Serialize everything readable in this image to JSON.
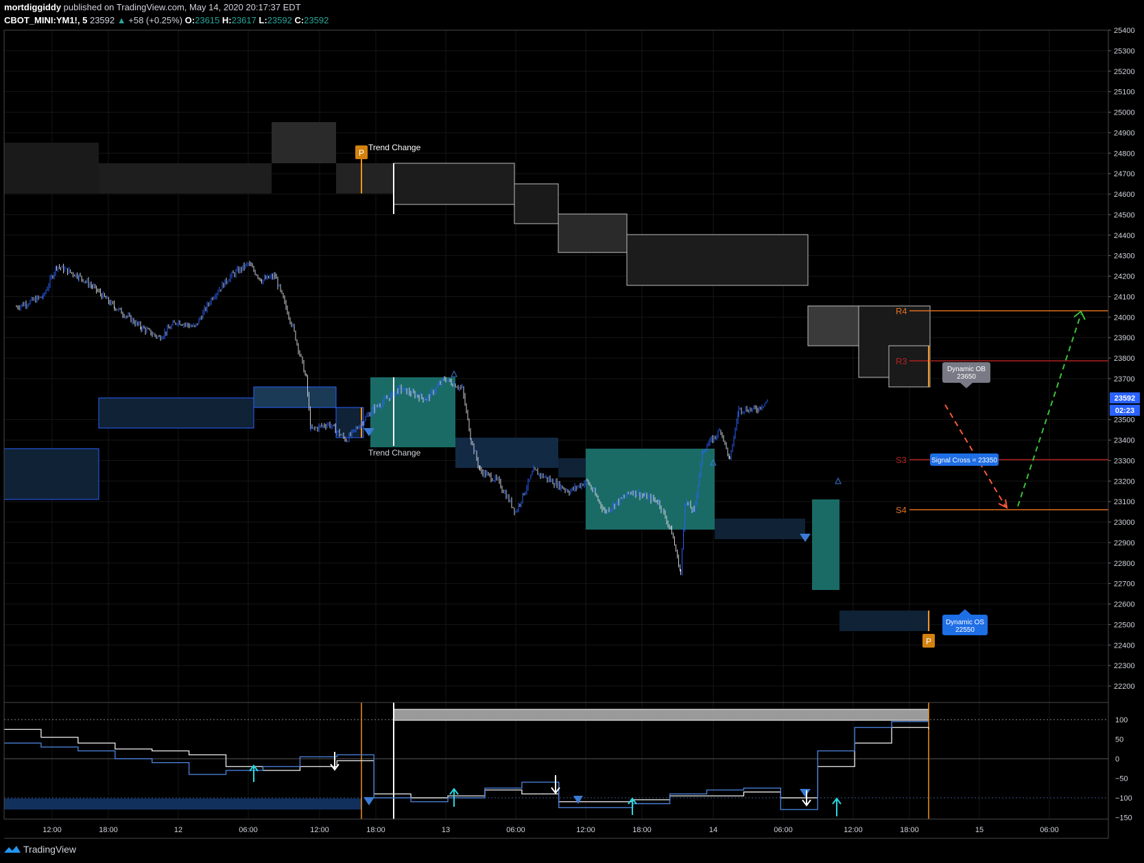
{
  "header": {
    "author": "mortdiggiddy",
    "published": "published on TradingView.com, May 14, 2020 20:17:37 EDT",
    "symbol": "CBOT_MINI:YM1!, 5",
    "last": "23592",
    "change": "+58 (+0.25%)",
    "o_label": "O:",
    "o": "23615",
    "h_label": "H:",
    "h": "23617",
    "l_label": "L:",
    "l": "23592",
    "c_label": "C:",
    "c": "23592"
  },
  "price_axis": {
    "ticks": [
      "25400",
      "25300",
      "25200",
      "25100",
      "25000",
      "24900",
      "24800",
      "24700",
      "24600",
      "24500",
      "24400",
      "24300",
      "24200",
      "24100",
      "24000",
      "23900",
      "23800",
      "23700",
      "23500",
      "23400",
      "23300",
      "23200",
      "23100",
      "23000",
      "22900",
      "22800",
      "22700",
      "22600",
      "22500",
      "22400",
      "22300",
      "22200"
    ],
    "last_price_label": "23592",
    "countdown_label": "02:23"
  },
  "osc_axis": {
    "ticks": [
      "100",
      "50",
      "0",
      "−50",
      "−100",
      "−150"
    ]
  },
  "time_axis": {
    "ticks": [
      "12:00",
      "18:00",
      "12",
      "06:00",
      "12:00",
      "18:00",
      "13",
      "06:00",
      "12:00",
      "18:00",
      "14",
      "06:00",
      "12:00",
      "18:00",
      "15",
      "06:00"
    ]
  },
  "annotations": {
    "trend_change_top": "Trend Change",
    "trend_change_bottom": "Trend Change",
    "pivot_marker": "P",
    "dynamic_ob_title": "Dynamic OB",
    "dynamic_ob_value": "23650",
    "dynamic_os_title": "Dynamic OS",
    "dynamic_os_value": "22550",
    "signal_cross": "Signal Cross = 23350",
    "r4": "R4",
    "r3": "R3",
    "s3": "S3",
    "s4": "S4"
  },
  "colors": {
    "background": "#000000",
    "bull_candle": "#2962ff",
    "bear_candle": "#d1d4dc",
    "teal_zone": "#1a6b66",
    "blue_zone": "#1c3350",
    "pivot": "#f7931a",
    "r_level": "#e07020",
    "r3_level": "#b22222",
    "dyn_ob": "#787b86",
    "dyn_os": "#1e6ee6"
  },
  "chart_data": [
    {
      "type": "candlestick",
      "title": "",
      "y_range": [
        22150,
        25400
      ],
      "x_ticks": [
        "12:00",
        "18:00",
        "12",
        "06:00",
        "12:00",
        "18:00",
        "13",
        "06:00",
        "12:00",
        "18:00",
        "14",
        "06:00",
        "12:00",
        "18:00",
        "15",
        "06:00"
      ],
      "close_path": [
        {
          "t": "11 08:00",
          "v": 24050
        },
        {
          "t": "11 11:00",
          "v": 24100
        },
        {
          "t": "11 12:30",
          "v": 24250
        },
        {
          "t": "11 15:00",
          "v": 24200
        },
        {
          "t": "11 16:30",
          "v": 24150
        },
        {
          "t": "11 19:00",
          "v": 24050
        },
        {
          "t": "11 22:00",
          "v": 23950
        },
        {
          "t": "12 00:00",
          "v": 23900
        },
        {
          "t": "12 02:00",
          "v": 23980
        },
        {
          "t": "12 04:00",
          "v": 23950
        },
        {
          "t": "12 06:00",
          "v": 24100
        },
        {
          "t": "12 08:00",
          "v": 24200
        },
        {
          "t": "12 10:00",
          "v": 24260
        },
        {
          "t": "12 11:30",
          "v": 24180
        },
        {
          "t": "12 13:00",
          "v": 24200
        },
        {
          "t": "12 15:00",
          "v": 23950
        },
        {
          "t": "12 16:30",
          "v": 23700
        },
        {
          "t": "12 17:00",
          "v": 23450
        },
        {
          "t": "12 19:00",
          "v": 23480
        },
        {
          "t": "12 21:00",
          "v": 23400
        },
        {
          "t": "13 00:00",
          "v": 23550
        },
        {
          "t": "13 03:00",
          "v": 23650
        },
        {
          "t": "13 06:00",
          "v": 23600
        },
        {
          "t": "13 08:00",
          "v": 23700
        },
        {
          "t": "13 10:00",
          "v": 23650
        },
        {
          "t": "13 11:00",
          "v": 23400
        },
        {
          "t": "13 12:00",
          "v": 23250
        },
        {
          "t": "13 14:00",
          "v": 23200
        },
        {
          "t": "13 16:00",
          "v": 23050
        },
        {
          "t": "13 18:00",
          "v": 23250
        },
        {
          "t": "13 20:00",
          "v": 23200
        },
        {
          "t": "13 22:00",
          "v": 23150
        },
        {
          "t": "14 00:00",
          "v": 23200
        },
        {
          "t": "14 02:00",
          "v": 23050
        },
        {
          "t": "14 05:00",
          "v": 23150
        },
        {
          "t": "14 08:00",
          "v": 23100
        },
        {
          "t": "14 09:30",
          "v": 22950
        },
        {
          "t": "14 10:30",
          "v": 22750
        },
        {
          "t": "14 11:00",
          "v": 23100
        },
        {
          "t": "14 12:00",
          "v": 23050
        },
        {
          "t": "14 13:00",
          "v": 23350
        },
        {
          "t": "14 15:00",
          "v": 23450
        },
        {
          "t": "14 16:00",
          "v": 23300
        },
        {
          "t": "14 17:00",
          "v": 23550
        },
        {
          "t": "14 19:00",
          "v": 23550
        },
        {
          "t": "14 20:15",
          "v": 23592
        }
      ],
      "levels": [
        {
          "name": "R4",
          "value": 24020
        },
        {
          "name": "R3",
          "value": 23780
        },
        {
          "name": "S3",
          "value": 23290
        },
        {
          "name": "S4",
          "value": 23040
        },
        {
          "name": "Dynamic OB",
          "value": 23650
        },
        {
          "name": "Dynamic OS",
          "value": 22550
        },
        {
          "name": "Signal Cross",
          "value": 23350
        }
      ],
      "projection": [
        {
          "t": "14 20:30",
          "v": 23520
        },
        {
          "t": "15 01:30",
          "v": 23070
        },
        {
          "t": "15 06:00",
          "v": 24000
        }
      ]
    },
    {
      "type": "line",
      "title": "",
      "y_range": [
        -150,
        120
      ],
      "y_ticks": [
        100,
        50,
        0,
        -50,
        -100,
        -150
      ],
      "reference_lines": [
        100,
        -100
      ],
      "series": [
        {
          "values": [
            75,
            55,
            40,
            25,
            20,
            10,
            -20,
            -30,
            -20,
            -5,
            -90,
            -100,
            -95,
            -80,
            -90,
            -110,
            -110,
            -105,
            -95,
            -95,
            -85,
            -100,
            -20,
            40,
            80,
            75
          ]
        },
        {
          "values": [
            40,
            30,
            20,
            0,
            -10,
            -40,
            -30,
            -20,
            5,
            10,
            -100,
            -110,
            -100,
            -75,
            -60,
            -125,
            -125,
            -115,
            -90,
            -80,
            -75,
            -130,
            20,
            80,
            95,
            95
          ]
        }
      ]
    }
  ]
}
